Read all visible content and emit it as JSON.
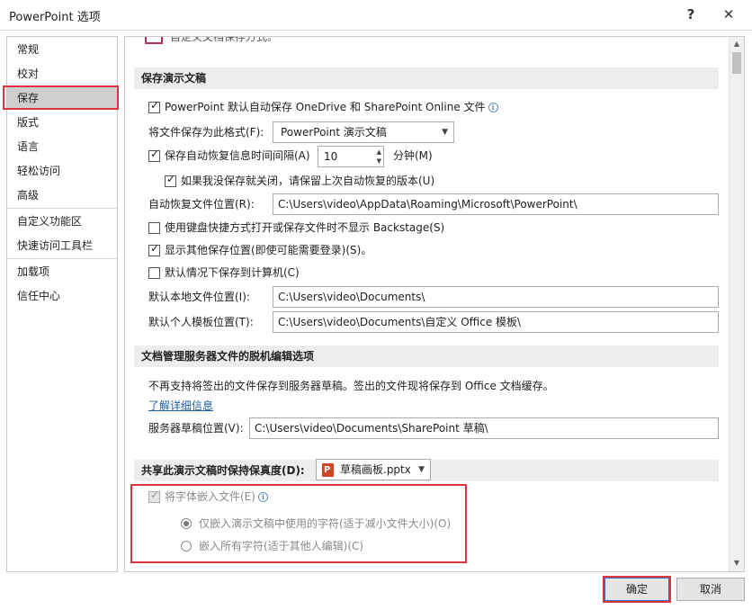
{
  "window": {
    "title": "PowerPoint 选项",
    "help_label": "?",
    "close_label": "✕"
  },
  "sidebar": {
    "items": [
      {
        "label": "常规"
      },
      {
        "label": "校对"
      },
      {
        "label": "保存"
      },
      {
        "label": "版式"
      },
      {
        "label": "语言"
      },
      {
        "label": "轻松访问"
      },
      {
        "label": "高级"
      },
      {
        "label": "自定义功能区"
      },
      {
        "label": "快速访问工具栏"
      },
      {
        "label": "加载项"
      },
      {
        "label": "信任中心"
      }
    ],
    "selected": "保存"
  },
  "content": {
    "top_cut_text": "自定义文档保存方式。",
    "save_section": {
      "header": "保存演示文稿",
      "autosave_onedrive": "PowerPoint 默认自动保存 OneDrive 和 SharePoint Online 文件",
      "format_label": "将文件保存为此格式(F):",
      "format_value": "PowerPoint 演示文稿",
      "autorecover_label": "保存自动恢复信息时间间隔(A)",
      "autorecover_value": "10",
      "minutes_label": "分钟(M)",
      "keep_last_label": "如果我没保存就关闭，请保留上次自动恢复的版本(U)",
      "autorecover_location_label": "自动恢复文件位置(R):",
      "autorecover_location_value": "C:\\Users\\video\\AppData\\Roaming\\Microsoft\\PowerPoint\\",
      "no_backstage_label": "使用键盘快捷方式打开或保存文件时不显示 Backstage(S)",
      "show_other_locations_label": "显示其他保存位置(即使可能需要登录)(S)。",
      "save_to_computer_label": "默认情况下保存到计算机(C)",
      "local_location_label": "默认本地文件位置(I):",
      "local_location_value": "C:\\Users\\video\\Documents\\",
      "template_location_label": "默认个人模板位置(T):",
      "template_location_value": "C:\\Users\\video\\Documents\\自定义 Office 模板\\"
    },
    "offline_section": {
      "header": "文档管理服务器文件的脱机编辑选项",
      "notice": "不再支持将签出的文件保存到服务器草稿。签出的文件现将保存到 Office 文档缓存。",
      "learn_more": "了解详细信息",
      "drafts_label": "服务器草稿位置(V):",
      "drafts_value": "C:\\Users\\video\\Documents\\SharePoint 草稿\\"
    },
    "fidelity_section": {
      "header": "共享此演示文稿时保持保真度(D):",
      "file_value": "草稿画板.pptx",
      "embed_fonts_label": "将字体嵌入文件(E)",
      "embed_used_label": "仅嵌入演示文稿中使用的字符(适于减小文件大小)(O)",
      "embed_all_label": "嵌入所有字符(适于其他人编辑)(C)"
    }
  },
  "footer": {
    "ok_label": "确定",
    "cancel_label": "取消"
  },
  "colors": {
    "highlight_red": "#d9363e",
    "link_blue": "#1f5fa8"
  }
}
